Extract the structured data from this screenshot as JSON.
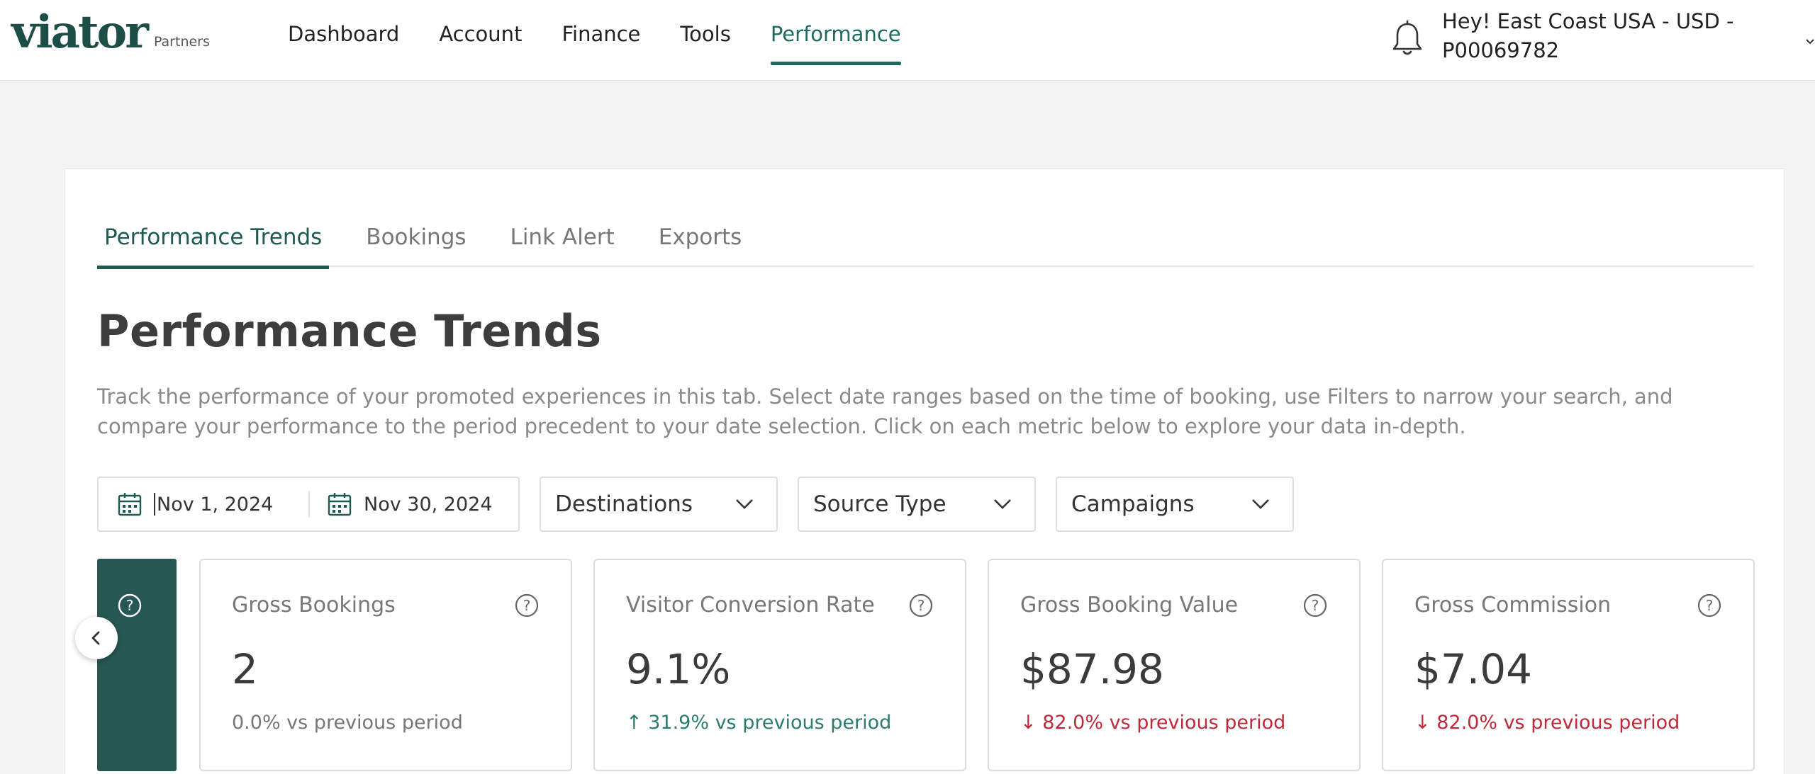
{
  "header": {
    "logo_text": "viator",
    "logo_sub": "Partners",
    "nav": [
      {
        "label": "Dashboard"
      },
      {
        "label": "Account"
      },
      {
        "label": "Finance"
      },
      {
        "label": "Tools"
      },
      {
        "label": "Performance",
        "active": true
      }
    ],
    "account_name": "Hey! East Coast USA - USD - P00069782"
  },
  "subtabs": [
    {
      "label": "Performance Trends",
      "active": true
    },
    {
      "label": "Bookings"
    },
    {
      "label": "Link Alert"
    },
    {
      "label": "Exports"
    }
  ],
  "page": {
    "title": "Performance Trends",
    "description": "Track the performance of your promoted experiences in this tab. Select date ranges based on the time of booking, use Filters to narrow your search, and compare your performance to the period precedent to your date selection. Click on each metric below to explore your data in-depth."
  },
  "filters": {
    "start_date": "Nov 1, 2024",
    "end_date": "Nov 30, 2024",
    "destinations": "Destinations",
    "source_type": "Source Type",
    "campaigns": "Campaigns"
  },
  "metrics": [
    {
      "label": "Gross Bookings",
      "value": "2",
      "change": "0.0% vs previous period",
      "trend": "neutral"
    },
    {
      "label": "Visitor Conversion Rate",
      "value": "9.1%",
      "change": "31.9% vs previous period",
      "trend": "up"
    },
    {
      "label": "Gross Booking Value",
      "value": "$87.98",
      "change": "82.0% vs previous period",
      "trend": "down"
    },
    {
      "label": "Gross Commission",
      "value": "$7.04",
      "change": "82.0% vs previous period",
      "trend": "down"
    }
  ],
  "colors": {
    "brand": "#1d4d47",
    "accent": "#1d6b60",
    "active_tile": "#275753",
    "up": "#2a7d6e",
    "down": "#c02939"
  }
}
